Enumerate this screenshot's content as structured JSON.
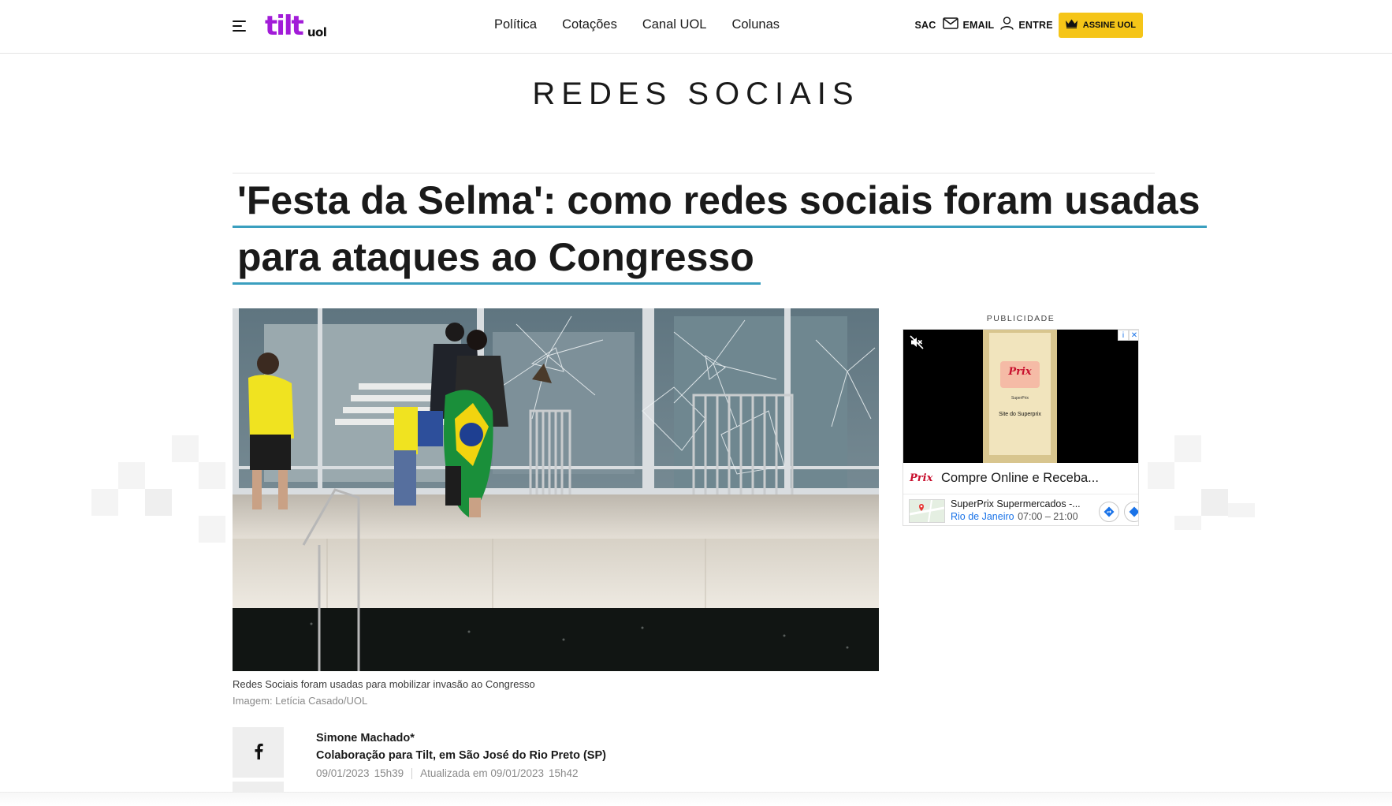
{
  "header": {
    "logo_primary": "tilt",
    "logo_secondary": "uol",
    "nav": [
      "Política",
      "Cotações",
      "Canal UOL",
      "Colunas"
    ],
    "sac_label": "SAC",
    "email_label": "EMAIL",
    "login_label": "ENTRE",
    "subscribe_label": "ASSINE UOL"
  },
  "section": {
    "title": "REDES SOCIAIS"
  },
  "article": {
    "headline_lines": [
      "'Festa da Selma': como redes sociais foram usadas",
      "para ataques ao Congresso"
    ],
    "photo_caption": "Redes Sociais foram usadas para mobilizar invasão ao Congresso",
    "photo_credit": "Imagem: Letícia Casado/UOL",
    "author": "Simone Machado*",
    "collaboration": "Colaboração para Tilt, em São José do Rio Preto (SP)",
    "published_date": "09/01/2023",
    "published_time": "15h39",
    "updated_label": "Atualizada em 09/01/2023",
    "updated_time": "15h42"
  },
  "ad": {
    "label": "PUBLICIDADE",
    "brand": "Prix",
    "phone_text_1": "SuperPrix",
    "phone_text_2": "Site do Superprix",
    "headline": "Compre Online e Receba...",
    "store_name": "SuperPrix Supermercados -...",
    "store_city": "Rio de Janeiro",
    "store_hours": "07:00 – 21:00",
    "choices_info": "i",
    "choices_close": "✕"
  },
  "colors": {
    "brand_purple": "#a21cd8",
    "subscribe_yellow": "#f5c518",
    "headline_underline": "#3a9fbf",
    "ad_link_blue": "#1a73e8"
  }
}
